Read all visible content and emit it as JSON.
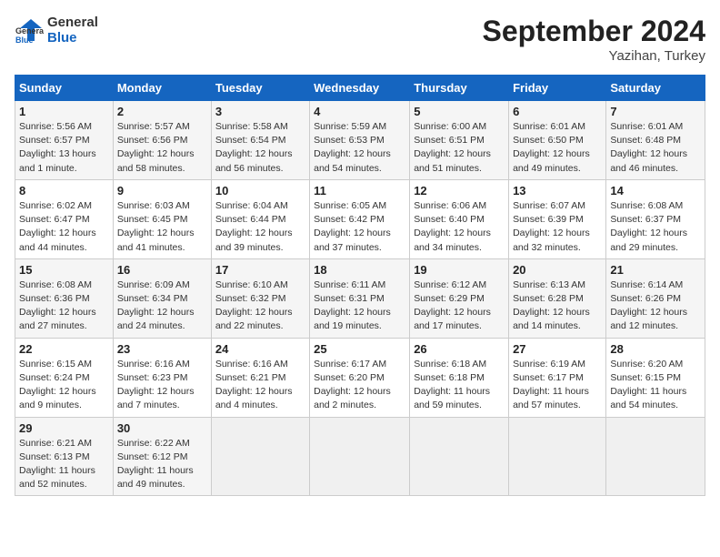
{
  "logo": {
    "line1": "General",
    "line2": "Blue"
  },
  "title": "September 2024",
  "location": "Yazihan, Turkey",
  "days_of_week": [
    "Sunday",
    "Monday",
    "Tuesday",
    "Wednesday",
    "Thursday",
    "Friday",
    "Saturday"
  ],
  "weeks": [
    [
      {
        "day": "1",
        "info": "Sunrise: 5:56 AM\nSunset: 6:57 PM\nDaylight: 13 hours\nand 1 minute."
      },
      {
        "day": "2",
        "info": "Sunrise: 5:57 AM\nSunset: 6:56 PM\nDaylight: 12 hours\nand 58 minutes."
      },
      {
        "day": "3",
        "info": "Sunrise: 5:58 AM\nSunset: 6:54 PM\nDaylight: 12 hours\nand 56 minutes."
      },
      {
        "day": "4",
        "info": "Sunrise: 5:59 AM\nSunset: 6:53 PM\nDaylight: 12 hours\nand 54 minutes."
      },
      {
        "day": "5",
        "info": "Sunrise: 6:00 AM\nSunset: 6:51 PM\nDaylight: 12 hours\nand 51 minutes."
      },
      {
        "day": "6",
        "info": "Sunrise: 6:01 AM\nSunset: 6:50 PM\nDaylight: 12 hours\nand 49 minutes."
      },
      {
        "day": "7",
        "info": "Sunrise: 6:01 AM\nSunset: 6:48 PM\nDaylight: 12 hours\nand 46 minutes."
      }
    ],
    [
      {
        "day": "8",
        "info": "Sunrise: 6:02 AM\nSunset: 6:47 PM\nDaylight: 12 hours\nand 44 minutes."
      },
      {
        "day": "9",
        "info": "Sunrise: 6:03 AM\nSunset: 6:45 PM\nDaylight: 12 hours\nand 41 minutes."
      },
      {
        "day": "10",
        "info": "Sunrise: 6:04 AM\nSunset: 6:44 PM\nDaylight: 12 hours\nand 39 minutes."
      },
      {
        "day": "11",
        "info": "Sunrise: 6:05 AM\nSunset: 6:42 PM\nDaylight: 12 hours\nand 37 minutes."
      },
      {
        "day": "12",
        "info": "Sunrise: 6:06 AM\nSunset: 6:40 PM\nDaylight: 12 hours\nand 34 minutes."
      },
      {
        "day": "13",
        "info": "Sunrise: 6:07 AM\nSunset: 6:39 PM\nDaylight: 12 hours\nand 32 minutes."
      },
      {
        "day": "14",
        "info": "Sunrise: 6:08 AM\nSunset: 6:37 PM\nDaylight: 12 hours\nand 29 minutes."
      }
    ],
    [
      {
        "day": "15",
        "info": "Sunrise: 6:08 AM\nSunset: 6:36 PM\nDaylight: 12 hours\nand 27 minutes."
      },
      {
        "day": "16",
        "info": "Sunrise: 6:09 AM\nSunset: 6:34 PM\nDaylight: 12 hours\nand 24 minutes."
      },
      {
        "day": "17",
        "info": "Sunrise: 6:10 AM\nSunset: 6:32 PM\nDaylight: 12 hours\nand 22 minutes."
      },
      {
        "day": "18",
        "info": "Sunrise: 6:11 AM\nSunset: 6:31 PM\nDaylight: 12 hours\nand 19 minutes."
      },
      {
        "day": "19",
        "info": "Sunrise: 6:12 AM\nSunset: 6:29 PM\nDaylight: 12 hours\nand 17 minutes."
      },
      {
        "day": "20",
        "info": "Sunrise: 6:13 AM\nSunset: 6:28 PM\nDaylight: 12 hours\nand 14 minutes."
      },
      {
        "day": "21",
        "info": "Sunrise: 6:14 AM\nSunset: 6:26 PM\nDaylight: 12 hours\nand 12 minutes."
      }
    ],
    [
      {
        "day": "22",
        "info": "Sunrise: 6:15 AM\nSunset: 6:24 PM\nDaylight: 12 hours\nand 9 minutes."
      },
      {
        "day": "23",
        "info": "Sunrise: 6:16 AM\nSunset: 6:23 PM\nDaylight: 12 hours\nand 7 minutes."
      },
      {
        "day": "24",
        "info": "Sunrise: 6:16 AM\nSunset: 6:21 PM\nDaylight: 12 hours\nand 4 minutes."
      },
      {
        "day": "25",
        "info": "Sunrise: 6:17 AM\nSunset: 6:20 PM\nDaylight: 12 hours\nand 2 minutes."
      },
      {
        "day": "26",
        "info": "Sunrise: 6:18 AM\nSunset: 6:18 PM\nDaylight: 11 hours\nand 59 minutes."
      },
      {
        "day": "27",
        "info": "Sunrise: 6:19 AM\nSunset: 6:17 PM\nDaylight: 11 hours\nand 57 minutes."
      },
      {
        "day": "28",
        "info": "Sunrise: 6:20 AM\nSunset: 6:15 PM\nDaylight: 11 hours\nand 54 minutes."
      }
    ],
    [
      {
        "day": "29",
        "info": "Sunrise: 6:21 AM\nSunset: 6:13 PM\nDaylight: 11 hours\nand 52 minutes."
      },
      {
        "day": "30",
        "info": "Sunrise: 6:22 AM\nSunset: 6:12 PM\nDaylight: 11 hours\nand 49 minutes."
      },
      {
        "day": "",
        "info": ""
      },
      {
        "day": "",
        "info": ""
      },
      {
        "day": "",
        "info": ""
      },
      {
        "day": "",
        "info": ""
      },
      {
        "day": "",
        "info": ""
      }
    ]
  ]
}
